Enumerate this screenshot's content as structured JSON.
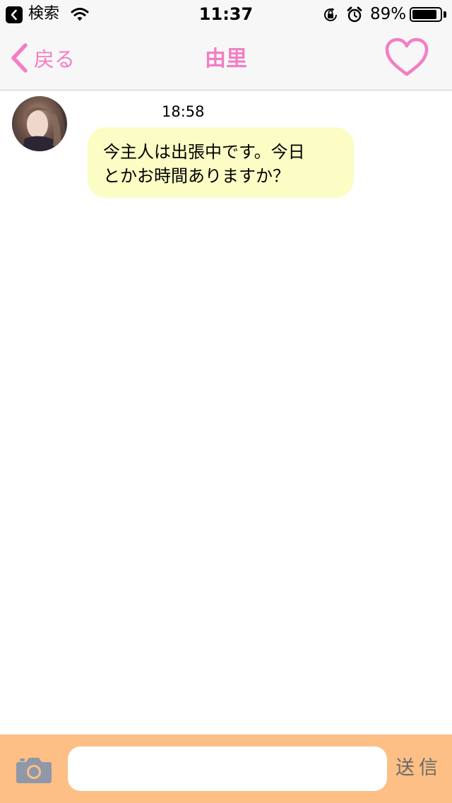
{
  "status_bar": {
    "back_app_label": "検索",
    "time": "11:37",
    "battery_percent_label": "89%",
    "battery_level": 0.89,
    "icons": [
      "back-app-icon",
      "wifi-icon",
      "rotation-lock-icon",
      "alarm-icon",
      "battery-icon"
    ]
  },
  "nav": {
    "back_label": "戻る",
    "title": "由里",
    "favorite_icon": "heart-outline-icon"
  },
  "chat": {
    "messages": [
      {
        "time": "18:58",
        "text_line1": "今主人は出張中です。今日",
        "text_line2": "とかお時間ありますか？",
        "sender_avatar": "avatar"
      }
    ]
  },
  "input_bar": {
    "camera_icon": "camera-icon",
    "input_value": "",
    "input_placeholder": "",
    "send_label": "送信"
  },
  "colors": {
    "accent_pink": "#f37ec3",
    "bubble_yellow": "#fbfdc5",
    "input_bar_orange": "#fdbf85",
    "bar_gray": "#f7f7f7"
  }
}
